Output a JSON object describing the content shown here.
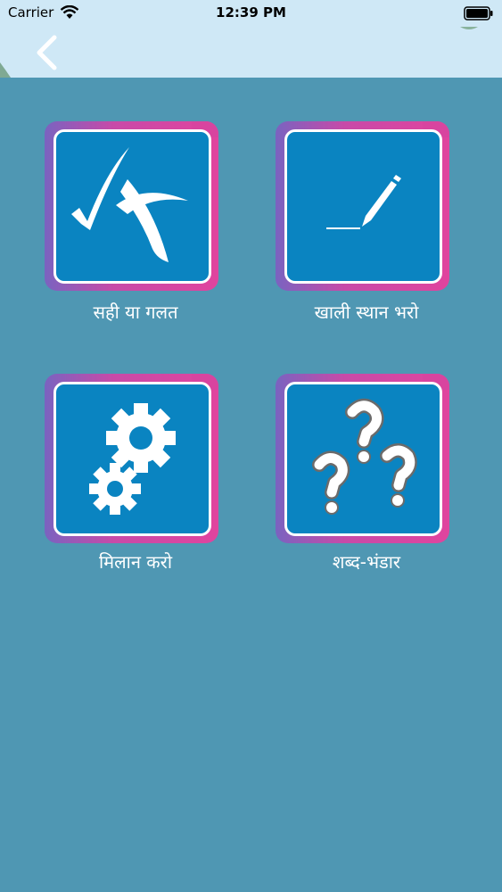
{
  "status_bar": {
    "carrier": "Carrier",
    "time": "12:39 PM",
    "wifi_icon": "wifi-icon",
    "battery_icon": "battery-icon"
  },
  "nav": {
    "back_icon": "chevron-left-icon",
    "background": "#cfe8f6"
  },
  "colors": {
    "page_background": "#4f97b3",
    "tile_fill": "#0a84c1",
    "tile_border_gradient": [
      "#7a63c0",
      "#e0449e"
    ],
    "label_text": "#ffffff"
  },
  "menu": [
    {
      "label": "सही या गलत",
      "icon": "check-cross-icon"
    },
    {
      "label": "खाली स्थान भरो",
      "icon": "pencil-line-icon"
    },
    {
      "label": "मिलान करो",
      "icon": "gears-icon"
    },
    {
      "label": "शब्द-भंडार",
      "icon": "question-marks-icon"
    }
  ]
}
